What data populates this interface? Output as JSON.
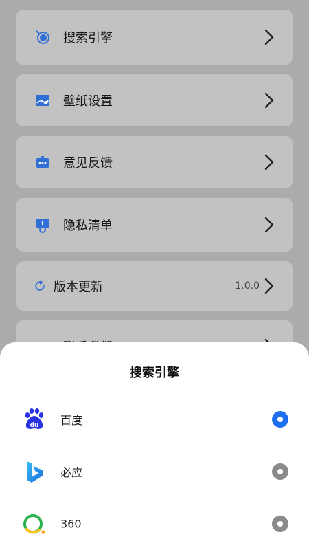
{
  "settings": {
    "items": [
      {
        "label": "搜索引擎",
        "icon": "search-engine-icon"
      },
      {
        "label": "壁纸设置",
        "icon": "wallpaper-icon"
      },
      {
        "label": "意见反馈",
        "icon": "feedback-icon"
      },
      {
        "label": "隐私清单",
        "icon": "privacy-icon"
      },
      {
        "label": "版本更新",
        "icon": "refresh-icon",
        "value": "1.0.0"
      },
      {
        "label": "联系我们",
        "icon": "contact-icon"
      }
    ]
  },
  "sheet": {
    "title": "搜索引擎",
    "options": [
      {
        "label": "百度",
        "logo": "baidu-logo",
        "selected": true
      },
      {
        "label": "必应",
        "logo": "bing-logo",
        "selected": false
      },
      {
        "label": "360",
        "logo": "360-logo",
        "selected": false
      }
    ]
  },
  "colors": {
    "accent": "#1e6ff0",
    "icon_blue": "#2f6fd6",
    "radio_off": "#8a8a8a"
  }
}
